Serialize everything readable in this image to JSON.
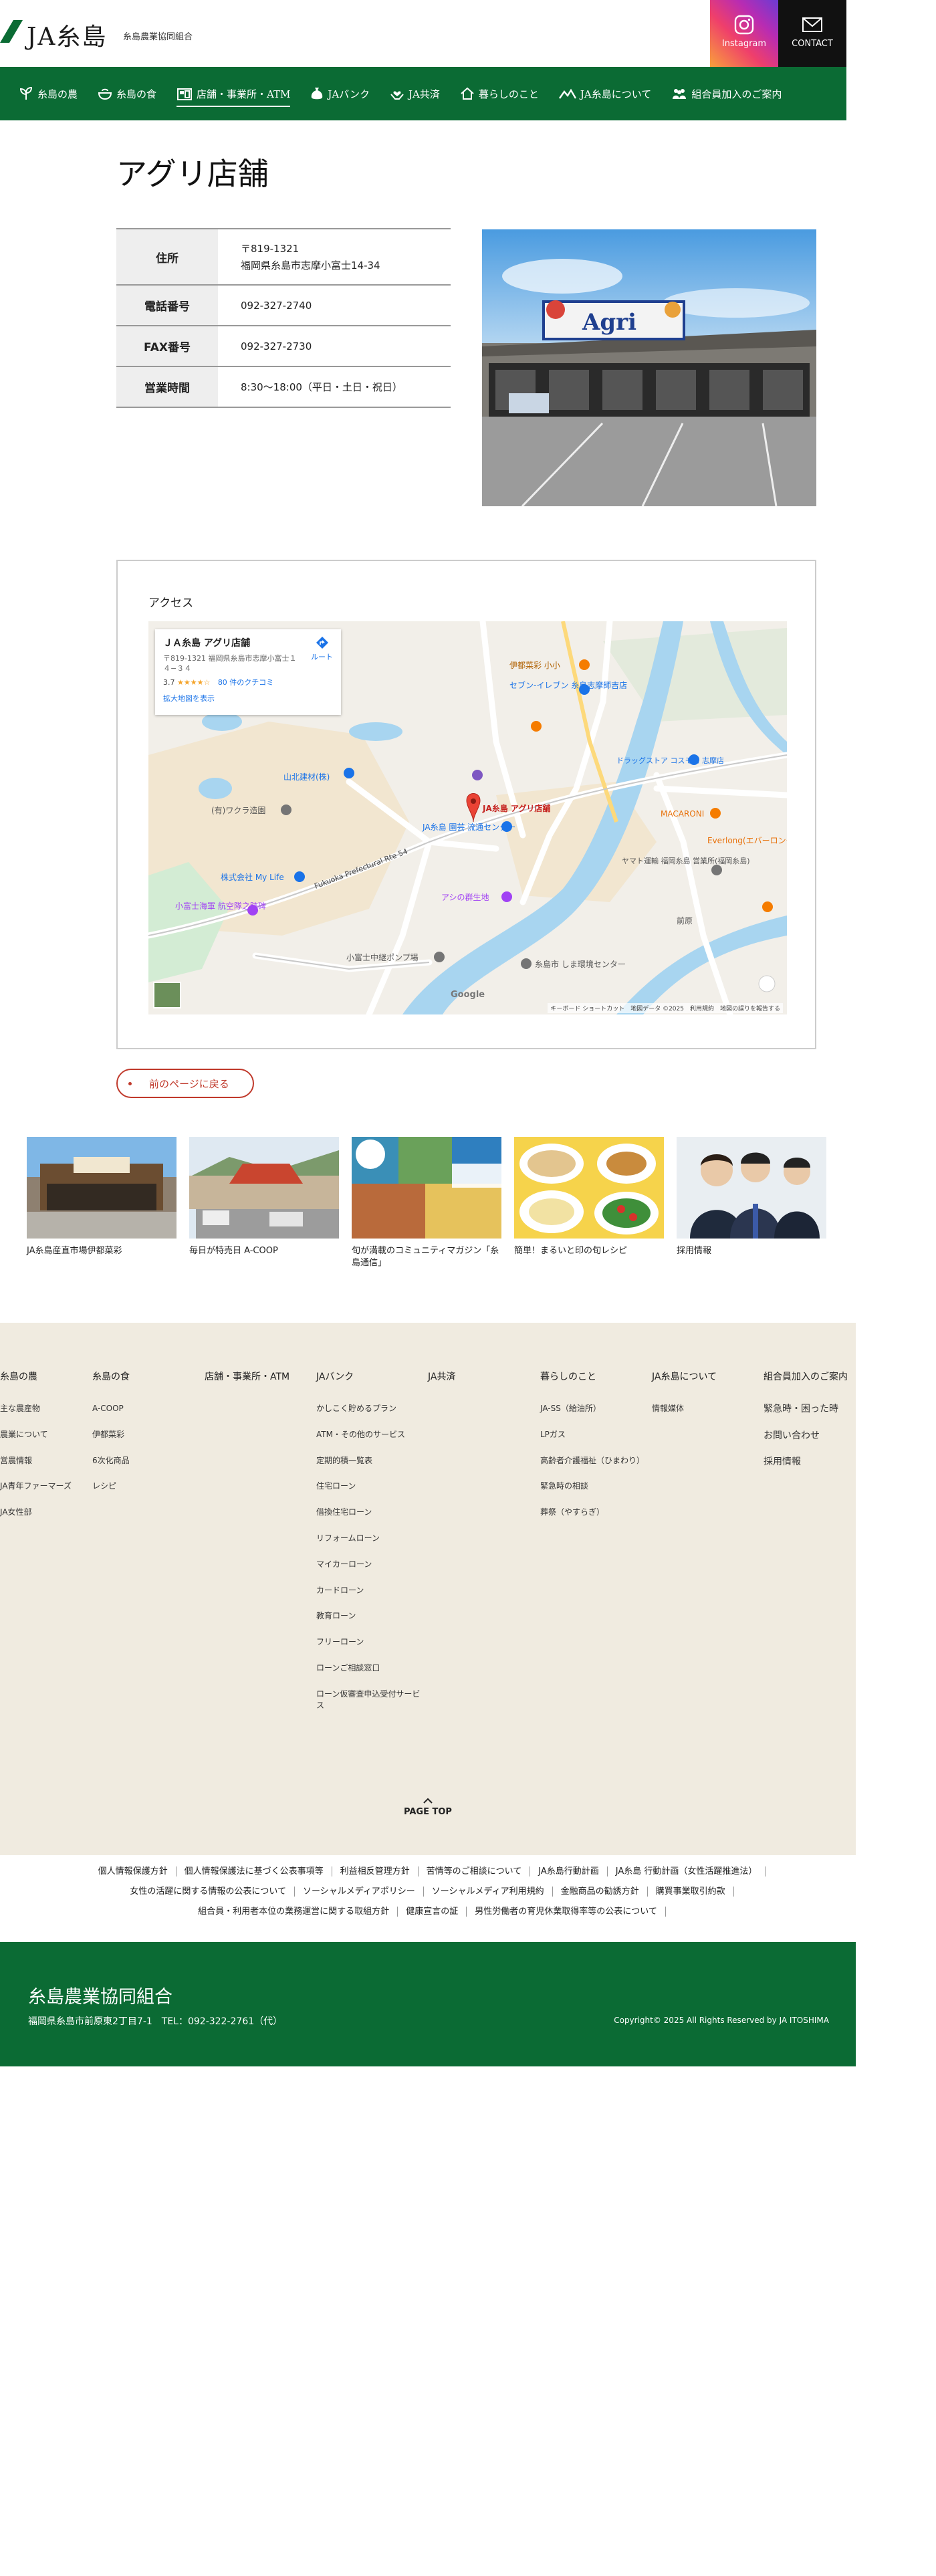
{
  "header": {
    "logo_text": "JA糸島",
    "logo_sub": "糸島農業協同組合",
    "instagram_label": "Instagram",
    "contact_label": "CONTACT"
  },
  "nav": [
    {
      "label": "糸島の農",
      "icon": "sprout-icon"
    },
    {
      "label": "糸島の食",
      "icon": "bowl-icon"
    },
    {
      "label": "店舗・事業所・ATM",
      "icon": "store-icon",
      "active": true
    },
    {
      "label": "JAバンク",
      "icon": "money-bag-icon"
    },
    {
      "label": "JA共済",
      "icon": "heart-hands-icon"
    },
    {
      "label": "暮らしのこと",
      "icon": "house-icon"
    },
    {
      "label": "JA糸島について",
      "icon": "mountain-icon"
    },
    {
      "label": "組合員加入のご案内",
      "icon": "people-icon"
    }
  ],
  "page": {
    "title": "アグリ店舗"
  },
  "store": {
    "address_label": "住所",
    "postal": "〒819-1321",
    "address": "福岡県糸島市志摩小富士14-34",
    "tel_label": "電話番号",
    "tel": "092-327-2740",
    "fax_label": "FAX番号",
    "fax": "092-327-2730",
    "hours_label": "営業時間",
    "hours": "8:30～18:00（平日・土日・祝日）",
    "sign_text": "Agri"
  },
  "access": {
    "title": "アクセス",
    "map_card": {
      "name": "ＪＡ糸島 アグリ店舗",
      "address": "〒819-1321 福岡県糸島市志摩小富士１４−３４",
      "rating": "3.7",
      "stars": "★★★★☆",
      "reviews": "80 件のクチコミ",
      "enlarge": "拡大地図を表示",
      "route": "ルート"
    },
    "map_labels": {
      "pin": "JA糸島 アグリ店舗",
      "ito_saikaen": "伊都菜彩 ⼩⼩",
      "seven": "セブン-イレブン 糸島志摩師吉店",
      "yamazaki": "山北建材(株)",
      "wakura": "(有)ワクラ造園",
      "mylife": "株式会社 My Life",
      "kofuji": "小富士海軍 航空隊之跡碑",
      "center": "JA糸島 園芸 流通センター",
      "ashino": "アシの群生地",
      "pump": "小富士中継ポンプ場",
      "shimashubu": "糸島市 しま環境センター",
      "macaroni": "MACARONI",
      "everlong": "Everlong(エバーロング)",
      "yamato": "ヤマト運輸 福岡糸島 営業所(福岡糸島)",
      "drugstore": "ドラッグストア コスモス 志摩店",
      "road": "Fukuoka Prefectural Rte 54",
      "hatsu": "前原",
      "google": "Google",
      "footer": "キーボード ショートカット　地図データ ©2025　利用規約　地図の誤りを報告する"
    },
    "back_label": "前のページに戻る"
  },
  "banners": [
    {
      "label": "JA糸島産直市場伊都菜彩"
    },
    {
      "label": "毎日が特売日 A-COOP"
    },
    {
      "label": "旬が満載のコミュニティマガジン「糸島通信」"
    },
    {
      "label": "簡単！まるいと印の旬レシピ"
    },
    {
      "label": "採用情報"
    }
  ],
  "sitemap": {
    "col1": {
      "head": "糸島の農",
      "links": [
        "主な農産物",
        "農業について",
        "営農情報",
        "JA青年ファーマーズ",
        "JA女性部"
      ]
    },
    "col2": {
      "head": "糸島の食",
      "links": [
        "A-COOP",
        "伊都菜彩",
        "6次化商品",
        "レシピ"
      ]
    },
    "col3": {
      "head": "店舗・事業所・ATM",
      "links": []
    },
    "col4": {
      "head": "JAバンク",
      "links": [
        "かしこく貯めるプラン",
        "ATM・その他のサービス",
        "定期的積一覧表",
        "住宅ローン",
        "借換住宅ローン",
        "リフォームローン",
        "マイカーローン",
        "カードローン",
        "教育ローン",
        "フリーローン",
        "ローンご相談窓口",
        "ローン仮審査申込受付サービス"
      ]
    },
    "col5": {
      "head": "JA共済",
      "links": []
    },
    "col6": {
      "head": "暮らしのこと",
      "links": [
        "JA-SS（給油所）",
        "LPガス",
        "高齢者介護福祉（ひまわり）",
        "緊急時の相談",
        "葬祭（やすらぎ）"
      ]
    },
    "col7": {
      "head": "JA糸島について",
      "links": [
        "情報媒体"
      ]
    },
    "col8": {
      "head": "組合員加入のご案内",
      "links": [
        "緊急時・困った時",
        "お問い合わせ",
        "採用情報"
      ]
    },
    "page_top": "PAGE TOP"
  },
  "policy": {
    "row1": [
      "個人情報保護方針",
      "個人情報保護法に基づく公表事項等",
      "利益相反管理方針",
      "苦情等のご相談について",
      "JA糸島行動計画",
      "JA糸島 行動計画（女性活躍推進法）"
    ],
    "row2": [
      "女性の活躍に関する情報の公表について",
      "ソーシャルメディアポリシー",
      "ソーシャルメディア利用規約",
      "金融商品の勧誘方針",
      "購買事業取引約款"
    ],
    "row3": [
      "組合員・利用者本位の業務運営に関する取組方針",
      "健康宣言の証",
      "男性労働者の育児休業取得率等の公表について"
    ]
  },
  "footer": {
    "name": "糸島農業協同組合",
    "address": "福岡県糸島市前原東2丁目7-1　TEL：092-322-2761（代）",
    "copyright": "Copyright© 2025 All Rights Reserved by JA ITOSHIMA"
  },
  "colors": {
    "brand_green": "#0b6b34",
    "accent_red": "#c0392b",
    "sitemap_bg": "#f0ebe0"
  }
}
